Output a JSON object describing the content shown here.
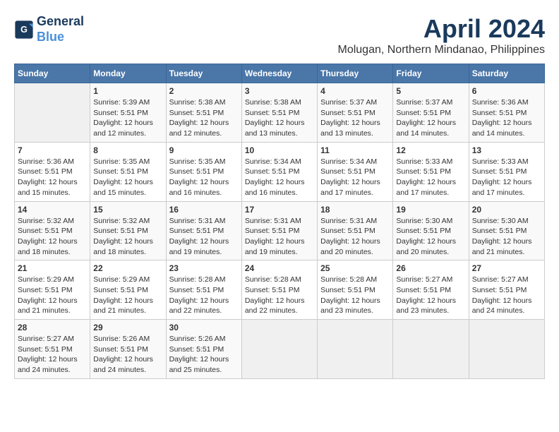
{
  "header": {
    "logo_line1": "General",
    "logo_line2": "Blue",
    "month_year": "April 2024",
    "location": "Molugan, Northern Mindanao, Philippines"
  },
  "days_of_week": [
    "Sunday",
    "Monday",
    "Tuesday",
    "Wednesday",
    "Thursday",
    "Friday",
    "Saturday"
  ],
  "weeks": [
    [
      {
        "day": "",
        "info": ""
      },
      {
        "day": "1",
        "info": "Sunrise: 5:39 AM\nSunset: 5:51 PM\nDaylight: 12 hours\nand 12 minutes."
      },
      {
        "day": "2",
        "info": "Sunrise: 5:38 AM\nSunset: 5:51 PM\nDaylight: 12 hours\nand 12 minutes."
      },
      {
        "day": "3",
        "info": "Sunrise: 5:38 AM\nSunset: 5:51 PM\nDaylight: 12 hours\nand 13 minutes."
      },
      {
        "day": "4",
        "info": "Sunrise: 5:37 AM\nSunset: 5:51 PM\nDaylight: 12 hours\nand 13 minutes."
      },
      {
        "day": "5",
        "info": "Sunrise: 5:37 AM\nSunset: 5:51 PM\nDaylight: 12 hours\nand 14 minutes."
      },
      {
        "day": "6",
        "info": "Sunrise: 5:36 AM\nSunset: 5:51 PM\nDaylight: 12 hours\nand 14 minutes."
      }
    ],
    [
      {
        "day": "7",
        "info": "Sunrise: 5:36 AM\nSunset: 5:51 PM\nDaylight: 12 hours\nand 15 minutes."
      },
      {
        "day": "8",
        "info": "Sunrise: 5:35 AM\nSunset: 5:51 PM\nDaylight: 12 hours\nand 15 minutes."
      },
      {
        "day": "9",
        "info": "Sunrise: 5:35 AM\nSunset: 5:51 PM\nDaylight: 12 hours\nand 16 minutes."
      },
      {
        "day": "10",
        "info": "Sunrise: 5:34 AM\nSunset: 5:51 PM\nDaylight: 12 hours\nand 16 minutes."
      },
      {
        "day": "11",
        "info": "Sunrise: 5:34 AM\nSunset: 5:51 PM\nDaylight: 12 hours\nand 17 minutes."
      },
      {
        "day": "12",
        "info": "Sunrise: 5:33 AM\nSunset: 5:51 PM\nDaylight: 12 hours\nand 17 minutes."
      },
      {
        "day": "13",
        "info": "Sunrise: 5:33 AM\nSunset: 5:51 PM\nDaylight: 12 hours\nand 17 minutes."
      }
    ],
    [
      {
        "day": "14",
        "info": "Sunrise: 5:32 AM\nSunset: 5:51 PM\nDaylight: 12 hours\nand 18 minutes."
      },
      {
        "day": "15",
        "info": "Sunrise: 5:32 AM\nSunset: 5:51 PM\nDaylight: 12 hours\nand 18 minutes."
      },
      {
        "day": "16",
        "info": "Sunrise: 5:31 AM\nSunset: 5:51 PM\nDaylight: 12 hours\nand 19 minutes."
      },
      {
        "day": "17",
        "info": "Sunrise: 5:31 AM\nSunset: 5:51 PM\nDaylight: 12 hours\nand 19 minutes."
      },
      {
        "day": "18",
        "info": "Sunrise: 5:31 AM\nSunset: 5:51 PM\nDaylight: 12 hours\nand 20 minutes."
      },
      {
        "day": "19",
        "info": "Sunrise: 5:30 AM\nSunset: 5:51 PM\nDaylight: 12 hours\nand 20 minutes."
      },
      {
        "day": "20",
        "info": "Sunrise: 5:30 AM\nSunset: 5:51 PM\nDaylight: 12 hours\nand 21 minutes."
      }
    ],
    [
      {
        "day": "21",
        "info": "Sunrise: 5:29 AM\nSunset: 5:51 PM\nDaylight: 12 hours\nand 21 minutes."
      },
      {
        "day": "22",
        "info": "Sunrise: 5:29 AM\nSunset: 5:51 PM\nDaylight: 12 hours\nand 21 minutes."
      },
      {
        "day": "23",
        "info": "Sunrise: 5:28 AM\nSunset: 5:51 PM\nDaylight: 12 hours\nand 22 minutes."
      },
      {
        "day": "24",
        "info": "Sunrise: 5:28 AM\nSunset: 5:51 PM\nDaylight: 12 hours\nand 22 minutes."
      },
      {
        "day": "25",
        "info": "Sunrise: 5:28 AM\nSunset: 5:51 PM\nDaylight: 12 hours\nand 23 minutes."
      },
      {
        "day": "26",
        "info": "Sunrise: 5:27 AM\nSunset: 5:51 PM\nDaylight: 12 hours\nand 23 minutes."
      },
      {
        "day": "27",
        "info": "Sunrise: 5:27 AM\nSunset: 5:51 PM\nDaylight: 12 hours\nand 24 minutes."
      }
    ],
    [
      {
        "day": "28",
        "info": "Sunrise: 5:27 AM\nSunset: 5:51 PM\nDaylight: 12 hours\nand 24 minutes."
      },
      {
        "day": "29",
        "info": "Sunrise: 5:26 AM\nSunset: 5:51 PM\nDaylight: 12 hours\nand 24 minutes."
      },
      {
        "day": "30",
        "info": "Sunrise: 5:26 AM\nSunset: 5:51 PM\nDaylight: 12 hours\nand 25 minutes."
      },
      {
        "day": "",
        "info": ""
      },
      {
        "day": "",
        "info": ""
      },
      {
        "day": "",
        "info": ""
      },
      {
        "day": "",
        "info": ""
      }
    ]
  ]
}
